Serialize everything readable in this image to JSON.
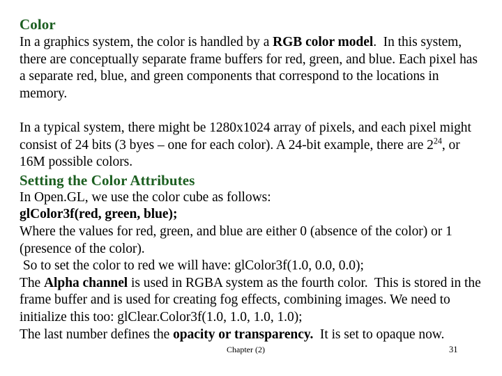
{
  "slide": {
    "title": "Color",
    "section_heading": "Setting the Color Attributes",
    "heading_color": "#1b5e20",
    "body_color": "#000000",
    "background_color": "#ffffff",
    "paragraph1": {
      "part1": "In a graphics system, the color is handled by a ",
      "bold1": "RGB color model",
      "part2": ".  In this system, there are conceptually separate frame buffers for red, green, and blue. Each pixel has a separate red, blue, and green components that correspond to the locations in memory."
    },
    "paragraph2": {
      "part1": "In a typical system, there might be 1280x1024 array of pixels, and each pixel might consist of 24 bits (3 byes – one for each color). A 24-bit example, there are 2",
      "sup1": "24",
      "part2": ", or 16M possible colors."
    },
    "line_opengl": "In Open.GL, we use the color cube as follows:",
    "line_glcolor3f": "glColor3f(red, green, blue);",
    "line_values": "Where the values for red, green, and blue are either 0 (absence of the color) or 1 (presence of the color).",
    "line_setred": " So to set the color to red we will have: glColor3f(1.0, 0.0, 0.0);",
    "line_alpha": {
      "part1": "The ",
      "bold1": "Alpha channel",
      "part2": " is used in RGBA system as the fourth color.  This is stored in the frame buffer and is used for creating fog effects, combining images. We need to initialize this too: glClear.Color3f(1.0, 1.0, 1.0, 1.0);"
    },
    "line_last": {
      "part1": "The last number defines the ",
      "bold1": "opacity or transparency.",
      "part2": "  It is set to opaque now."
    }
  },
  "footer": {
    "chapter": "Chapter (2)",
    "page_number": "31"
  }
}
